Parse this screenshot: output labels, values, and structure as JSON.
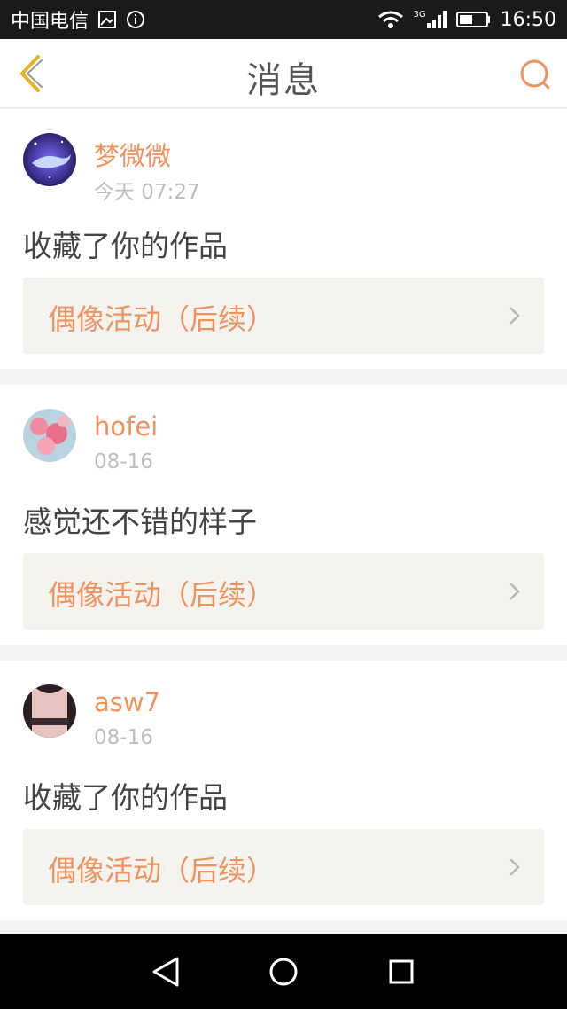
{
  "status_bar": {
    "carrier": "中国电信",
    "network": "3G",
    "time": "16:50"
  },
  "header": {
    "title": "消息",
    "back_icon": "chevron-left-icon",
    "search_icon": "search-icon"
  },
  "colors": {
    "accent": "#ee9260",
    "back_icon": "#e8b320",
    "title": "#555555",
    "timestamp": "#bdbdbd",
    "card_link_bg": "#f4f3ee"
  },
  "messages": [
    {
      "username": "梦微微",
      "time": "今天 07:27",
      "content": "收藏了你的作品",
      "work_title": "偶像活动（后续）"
    },
    {
      "username": "hofei",
      "time": "08-16",
      "content": "感觉还不错的样子",
      "work_title": "偶像活动（后续）"
    },
    {
      "username": "asw7",
      "time": "08-16",
      "content": "收藏了你的作品",
      "work_title": "偶像活动（后续）"
    }
  ],
  "nav_bar": {
    "back": "triangle-back-icon",
    "home": "circle-home-icon",
    "recents": "square-recents-icon"
  }
}
